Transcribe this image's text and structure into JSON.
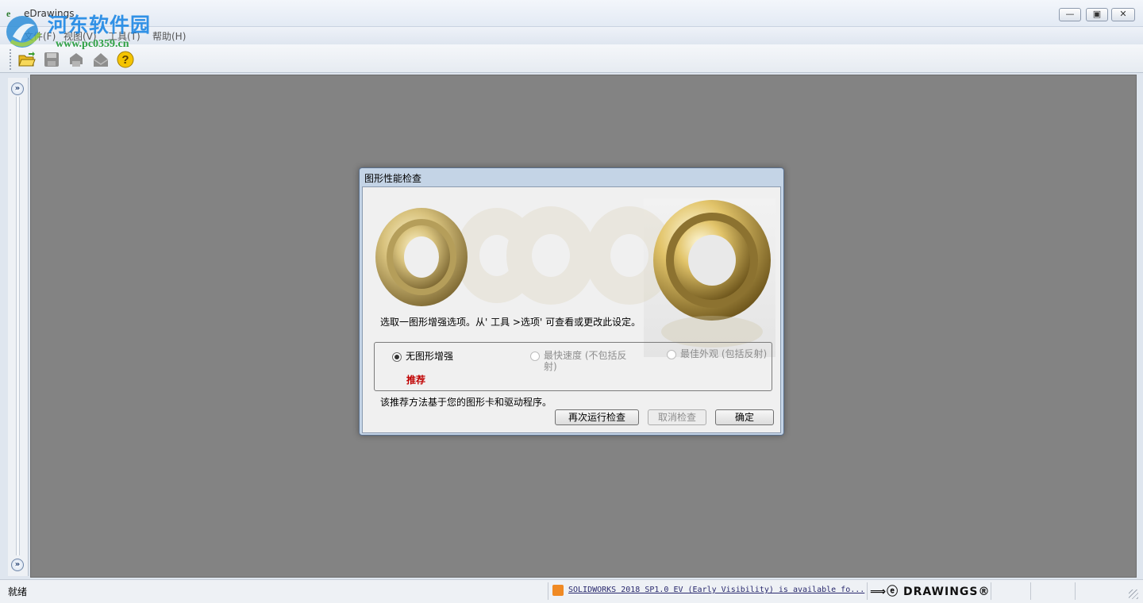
{
  "window": {
    "title": "eDrawings",
    "icon": "edrawings-app-icon",
    "minimize": "—",
    "maximize": "▣",
    "close": "✕"
  },
  "watermark": {
    "title": "河东软件园",
    "url": "www.pc0359.cn"
  },
  "menu": {
    "items": [
      "文件(F)",
      "视图(V)",
      "工具(T)",
      "帮助(H)"
    ]
  },
  "toolbar": {
    "icons": [
      "open-folder-icon",
      "save-icon",
      "print-icon",
      "send-icon",
      "help-icon"
    ]
  },
  "dialog": {
    "title": "图形性能检查",
    "instruction": "选取一图形增强选项。从' 工具 >选项' 可查看或更改此设定。",
    "options": [
      {
        "label": "无图形增强",
        "selected": true,
        "enabled": true
      },
      {
        "label": "最快速度 (不包括反射)",
        "selected": false,
        "enabled": false
      },
      {
        "label": "最佳外观 (包括反射)",
        "selected": false,
        "enabled": false
      }
    ],
    "recommended": "推荐",
    "note": "该推荐方法基于您的图形卡和驱动程序。",
    "buttons": {
      "rerun": "再次运行检查",
      "cancel": "取消检查",
      "ok": "确定"
    }
  },
  "statusbar": {
    "ready": "就绪",
    "news": "SOLIDWORKS 2018 SP1.0 EV (Early Visibility) is available fo...",
    "logo": "DRAWINGS®"
  },
  "colors": {
    "viewport": "#838383",
    "recommended": "#c00000",
    "accent": "#1e88e5"
  }
}
